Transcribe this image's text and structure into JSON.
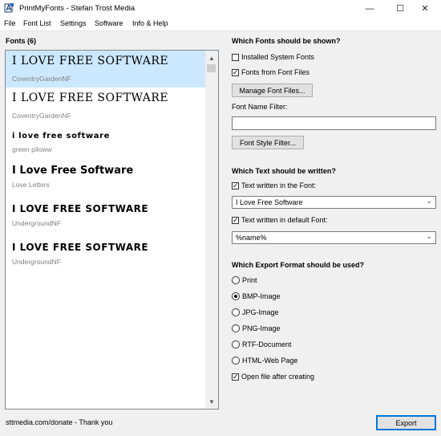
{
  "window": {
    "title": "PrintMyFonts - Stefan Trost Media",
    "minimize": "—",
    "maximize": "☐",
    "close": "✕"
  },
  "menu": [
    "File",
    "Font List",
    "Settings",
    "Software",
    "Info & Help"
  ],
  "fonts_header": "Fonts (6)",
  "fonts": [
    {
      "sample": "I LOVE FREE SOFTWARE",
      "name": "CoventryGardenNF",
      "selected": true
    },
    {
      "sample": "I LOVE FREE SOFTWARE",
      "name": "CoventryGardenNF",
      "selected": false
    },
    {
      "sample": "i love free software",
      "name": "green piloww",
      "selected": false
    },
    {
      "sample": "I Love Free Software",
      "name": "Love Letters",
      "selected": false
    },
    {
      "sample": "I LOVE FREE SOFTWARE",
      "name": "UndergroundNF",
      "selected": false
    },
    {
      "sample": "I LOVE FREE SOFTWARE",
      "name": "UndergroundNF",
      "selected": false
    }
  ],
  "which_fonts": {
    "heading": "Which Fonts should be shown?",
    "installed": {
      "label": "Installed System Fonts",
      "checked": false
    },
    "from_files": {
      "label": "Fonts from Font Files",
      "checked": true
    },
    "manage_button": "Manage Font Files...",
    "filter_label": "Font Name Filter:",
    "filter_value": "",
    "style_filter_button": "Font Style Filter..."
  },
  "which_text": {
    "heading": "Which Text should be written?",
    "in_font": {
      "label": "Text written in the Font:",
      "checked": true
    },
    "in_font_value": "I Love Free Software",
    "in_default": {
      "label": "Text written in default Font:",
      "checked": true
    },
    "in_default_value": "%name%"
  },
  "export": {
    "heading": "Which Export Format should be used?",
    "options": [
      {
        "label": "Print",
        "checked": false
      },
      {
        "label": "BMP-Image",
        "checked": true
      },
      {
        "label": "JPG-Image",
        "checked": false
      },
      {
        "label": "PNG-Image",
        "checked": false
      },
      {
        "label": "RTF-Document",
        "checked": false
      },
      {
        "label": "HTML-Web Page",
        "checked": false
      }
    ],
    "open_after": {
      "label": "Open file after creating",
      "checked": true
    },
    "button": "Export"
  },
  "status": "sttmedia.com/donate - Thank you"
}
